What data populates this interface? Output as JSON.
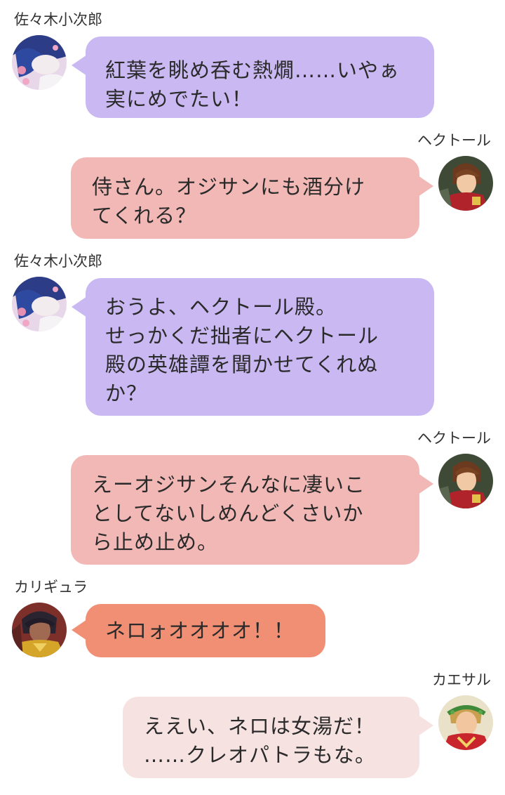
{
  "colors": {
    "kojiro_bubble": "#c9b8f1",
    "hector_bubble": "#f1b8b6",
    "caligula_bubble": "#f18f74",
    "caesar_bubble": "#f5e2e1"
  },
  "messages": [
    {
      "speaker": "佐々木小次郎",
      "side": "left",
      "avatar_icon": "kojiro-avatar-icon",
      "lines": [
        "紅葉を眺め呑む熱燗……いやぁ",
        "実にめでたい！"
      ]
    },
    {
      "speaker": "ヘクトール",
      "side": "right",
      "avatar_icon": "hector-avatar-icon",
      "lines": [
        "侍さん。オジサンにも酒分け",
        "てくれる？"
      ]
    },
    {
      "speaker": "佐々木小次郎",
      "side": "left",
      "avatar_icon": "kojiro-avatar-icon",
      "lines": [
        "おうよ、ヘクトール殿。",
        "せっかくだ拙者にヘクトール",
        "殿の英雄譚を聞かせてくれぬ",
        "か？"
      ]
    },
    {
      "speaker": "ヘクトール",
      "side": "right",
      "avatar_icon": "hector-avatar-icon",
      "lines": [
        "えーオジサンそんなに凄いこ",
        "としてないしめんどくさいか",
        "ら止め止め。"
      ]
    },
    {
      "speaker": "カリギュラ",
      "side": "left",
      "avatar_icon": "caligula-avatar-icon",
      "lines": [
        "ネロォオオオオ！！"
      ]
    },
    {
      "speaker": "カエサル",
      "side": "right",
      "avatar_icon": "caesar-avatar-icon",
      "lines": [
        "ええい、ネロは女湯だ！",
        "……クレオパトラもな。"
      ]
    }
  ]
}
